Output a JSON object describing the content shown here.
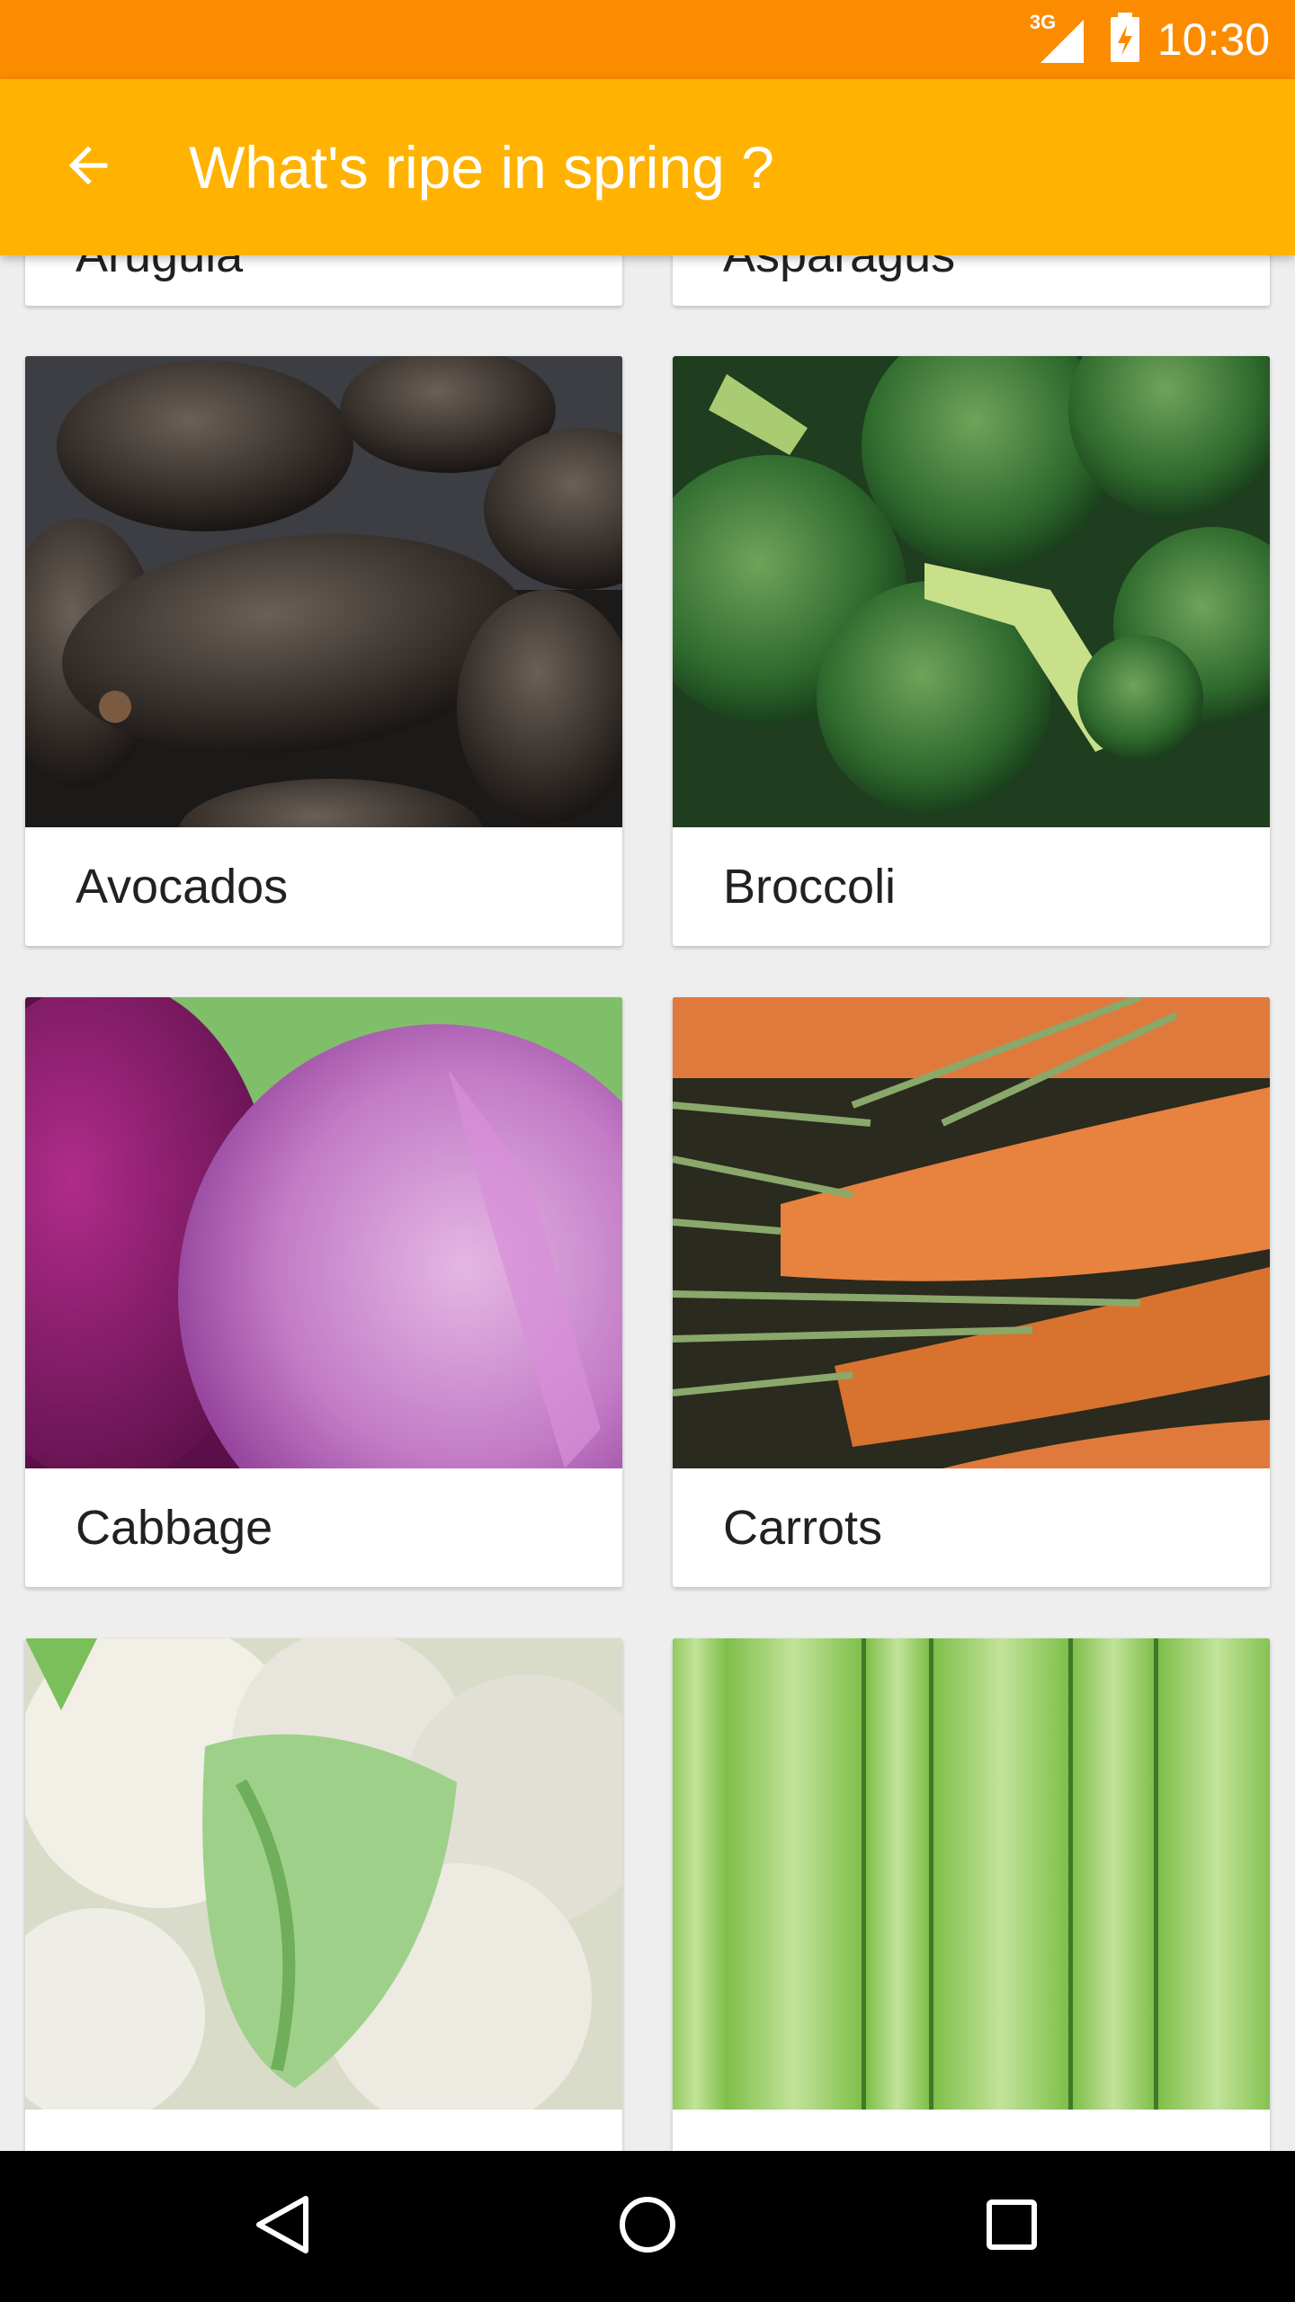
{
  "status_bar": {
    "network": "3G",
    "time": "10:30",
    "icons": [
      "signal-icon",
      "battery-charging-icon"
    ]
  },
  "app_bar": {
    "title": "What's ripe in spring ?",
    "back_icon": "arrow-back-icon"
  },
  "items": [
    {
      "label": "Arugula"
    },
    {
      "label": "Asparagus"
    },
    {
      "label": "Avocados"
    },
    {
      "label": "Broccoli"
    },
    {
      "label": "Cabbage"
    },
    {
      "label": "Carrots"
    },
    {
      "label": ""
    },
    {
      "label": ""
    }
  ],
  "nav_bar": {
    "back": "nav-back-icon",
    "home": "nav-home-icon",
    "recents": "nav-recents-icon"
  },
  "colors": {
    "status_bar": "#fb8c00",
    "app_bar": "#ffb300",
    "background": "#eeeeee"
  }
}
